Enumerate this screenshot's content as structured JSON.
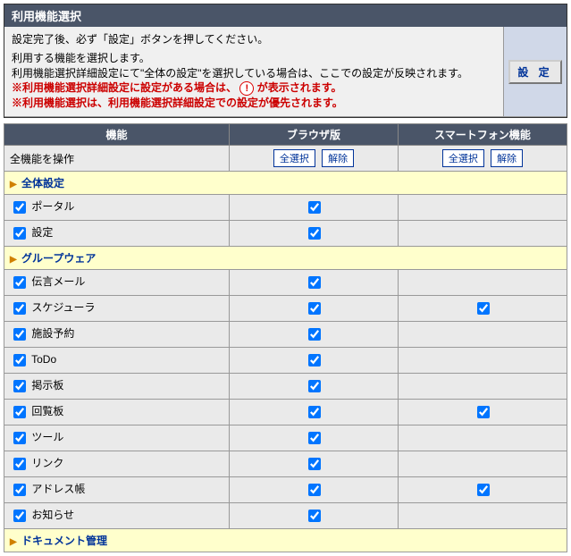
{
  "title": "利用機能選択",
  "info": {
    "line1": "設定完了後、必ず「設定」ボタンを押してください。",
    "line2": "利用する機能を選択します。",
    "line3": "利用機能選択詳細設定にて\"全体の設定\"を選択している場合は、ここでの設定が反映されます。",
    "warn1a": "※利用機能選択詳細設定に設定がある場合は、",
    "warn1b": "が表示されます。",
    "warn2": "※利用機能選択は、利用機能選択詳細設定での設定が優先されます。"
  },
  "settei_button": "設 定",
  "headers": {
    "func": "機能",
    "browser": "ブラウザ版",
    "smart": "スマートフォン機能"
  },
  "all_ops_label": "全機能を操作",
  "btn_select_all": "全選択",
  "btn_clear": "解除",
  "sections": [
    {
      "title": "全体設定",
      "rows": [
        {
          "label": "ポータル",
          "c0": true,
          "b": true,
          "s": false,
          "s_show": false
        },
        {
          "label": "設定",
          "c0": true,
          "b": true,
          "s": false,
          "s_show": false
        }
      ]
    },
    {
      "title": "グループウェア",
      "rows": [
        {
          "label": "伝言メール",
          "c0": true,
          "b": true,
          "s": false,
          "s_show": false
        },
        {
          "label": "スケジューラ",
          "c0": true,
          "b": true,
          "s": true,
          "s_show": true
        },
        {
          "label": "施設予約",
          "c0": true,
          "b": true,
          "s": false,
          "s_show": false
        },
        {
          "label": "ToDo",
          "c0": true,
          "b": true,
          "s": false,
          "s_show": false
        },
        {
          "label": "掲示板",
          "c0": true,
          "b": true,
          "s": false,
          "s_show": false
        },
        {
          "label": "回覧板",
          "c0": true,
          "b": true,
          "s": true,
          "s_show": true
        },
        {
          "label": "ツール",
          "c0": true,
          "b": true,
          "s": false,
          "s_show": false
        },
        {
          "label": "リンク",
          "c0": true,
          "b": true,
          "s": false,
          "s_show": false
        },
        {
          "label": "アドレス帳",
          "c0": true,
          "b": true,
          "s": true,
          "s_show": true
        },
        {
          "label": "お知らせ",
          "c0": true,
          "b": true,
          "s": false,
          "s_show": false
        }
      ]
    },
    {
      "title": "ドキュメント管理",
      "rows": []
    }
  ]
}
